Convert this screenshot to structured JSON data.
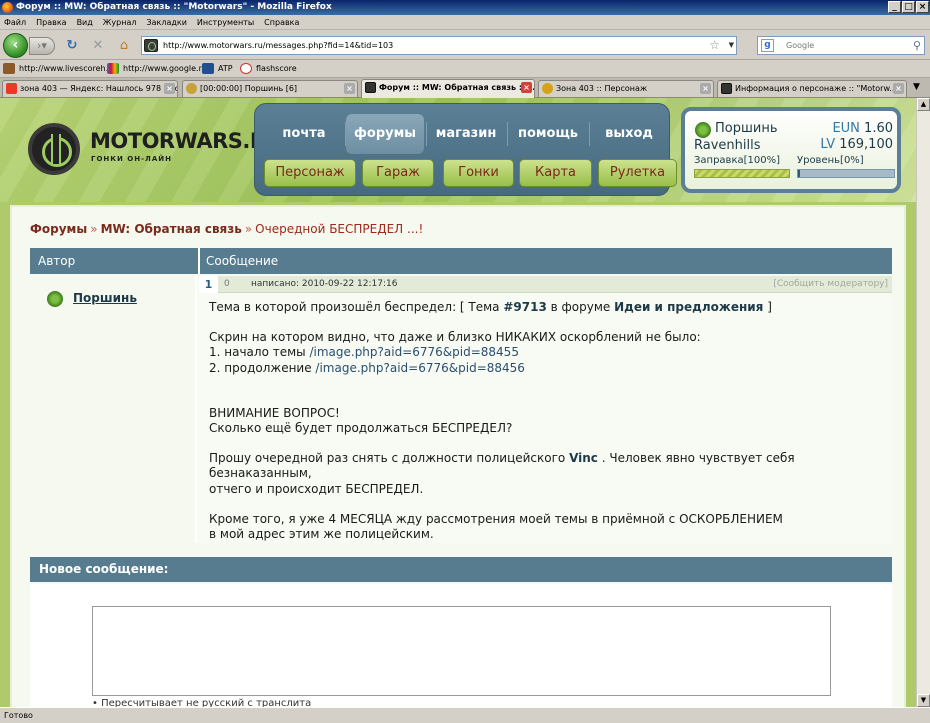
{
  "window": {
    "title": "Форум :: MW: Обратная связь :: \"Motorwars\" - Mozilla Firefox"
  },
  "menu": [
    "Файл",
    "Правка",
    "Вид",
    "Журнал",
    "Закладки",
    "Инструменты",
    "Справка"
  ],
  "address": {
    "url": "http://www.motorwars.ru/messages.php?fid=14&tid=103"
  },
  "search": {
    "placeholder": "Google"
  },
  "bookmarks": [
    {
      "label": "http://www.livescoreh...",
      "icon": "livescore-icon"
    },
    {
      "label": "http://www.google.ru/",
      "icon": "google-icon"
    },
    {
      "label": "ATP",
      "icon": "atp-icon"
    },
    {
      "label": "flashscore",
      "icon": "flashscore-icon"
    }
  ],
  "tabs": [
    {
      "label": "зона 403 — Яндекс: Нашлось 978 тыс...",
      "active": false
    },
    {
      "label": "[00:00:00] Поршинь [6]",
      "active": false
    },
    {
      "label": "Форум :: MW: Обратная связь :: \"...",
      "active": true
    },
    {
      "label": "Зона 403 :: Персонаж",
      "active": false
    },
    {
      "label": "Информация о персонаже :: \"Motorw...",
      "active": false
    }
  ],
  "site": {
    "logo_text": "MOTORWARS.RU",
    "logo_sub": "ГОНКИ ОН-ЛАЙН",
    "nav": [
      "почта",
      "форумы",
      "магазин",
      "помощь",
      "выход"
    ],
    "nav_active": 1,
    "subnav": [
      "Персонаж",
      "Гараж",
      "Гонки",
      "Карта",
      "Рулетка"
    ],
    "user": {
      "name": "Поршинь",
      "city": "Ravenhills",
      "eun_label": "EUN",
      "eun_value": "1.60",
      "lv_label": "LV",
      "lv_value": "169,100",
      "fuel_label": "Заправка[100%]",
      "fuel_level": 100,
      "level_label": "Уровень[0%]",
      "level_progress": 0
    }
  },
  "breadcrumb": {
    "root": "Форумы",
    "section": "MW: Обратная связь",
    "current": "Очередной БЕСПРЕДЕЛ ...!"
  },
  "table": {
    "col_author": "Автор",
    "col_message": "Сообщение"
  },
  "post": {
    "author": "Поршинь",
    "number": "1",
    "rating": "0",
    "date": "написано: 2010-09-22 12:17:16",
    "report": "[Сообщить модератору]",
    "line1_pre": "Тема в которой произошёл беспредел: [ Тема ",
    "line1_topic": "#9713",
    "line1_mid": " в форуме ",
    "line1_forum": "Идеи и предложения",
    "line1_post": " ]",
    "line2": "Скрин на котором видно, что даже и близко НИКАКИХ оскорблений не было:",
    "line3_pre": "1. начало темы ",
    "line3_link": "/image.php?aid=6776&pid=88455",
    "line4_pre": "2. продолжение ",
    "line4_link": "/image.php?aid=6776&pid=88456",
    "line5": "ВНИМАНИЕ ВОПРОС!",
    "line6": "Сколько ещё будет продолжаться БЕСПРЕДЕЛ?",
    "line7_pre": "Прошу очередной раз снять с должности полицейского ",
    "line7_name": "Vinc",
    "line7_post": " . Человек явно чувствует себя безнаказанным,",
    "line8": "отчего и происходит БЕСПРЕДЕЛ.",
    "line9": "Кроме того, я уже 4 МЕСЯЦА жду рассмотрения моей темы в приёмной с ОСКОРБЛЕНИЕМ",
    "line10": "в мой адрес этим же полицейским."
  },
  "new_message": {
    "header": "Новое сообщение:",
    "note": "• Пересчитывает не русский с транслита"
  },
  "status": {
    "text": "Готово"
  }
}
